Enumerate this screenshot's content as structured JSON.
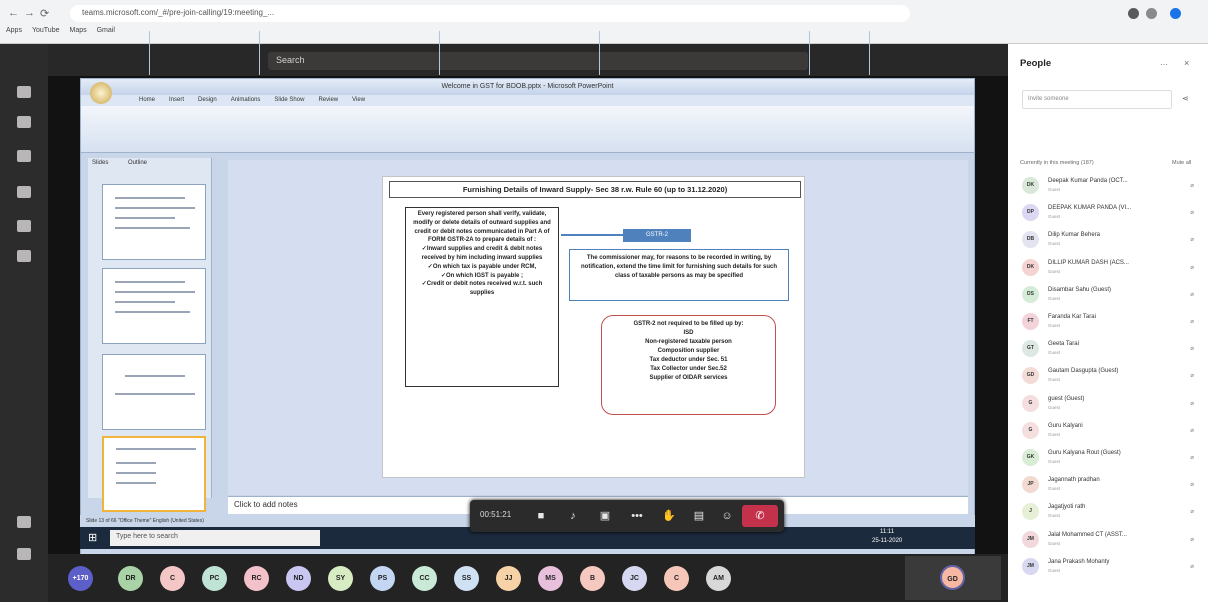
{
  "browser": {
    "url": "teams.microsoft.com/_#/pre-join-calling/19:meeting_...",
    "bookmarks": [
      "Apps",
      "YouTube",
      "Maps",
      "Gmail"
    ]
  },
  "teams": {
    "search_placeholder": "Search"
  },
  "ppt": {
    "title": "Welcome in GST for BDOB.pptx - Microsoft PowerPoint",
    "tabs": [
      "Home",
      "Insert",
      "Design",
      "Animations",
      "Slide Show",
      "Review",
      "View"
    ],
    "panel_tabs": [
      "Slides",
      "Outline"
    ],
    "notes": "Click to add notes",
    "status": "Slide 13 of 66   \"Office Theme\"   English (United States)"
  },
  "slide": {
    "title": "Furnishing Details of Inward Supply- Sec 38 r.w. Rule 60 (up to 31.12.2020)",
    "box_a": [
      "Every registered person shall verify, validate, modify or delete details of outward supplies and credit or debit notes communicated in Part A of FORM GSTR-2A to prepare details of :",
      "✓Inward supplies and credit & debit notes received by him including inward supplies",
      "✓On which tax is payable under RCM,",
      "✓On which IGST is payable ;",
      "✓Credit or debit notes received w.r.t. such supplies"
    ],
    "label": "GSTR-2",
    "box_b": "The commissioner may, for reasons to be recorded in writing, by notification, extend the time limit for furnishing such details for such class of taxable persons as may be specified",
    "box_c": [
      "GSTR-2 not required to be filled up by:",
      "ISD",
      "Non-registered taxable person",
      "Composition supplier",
      "Tax deductor under Sec. 51",
      "Tax Collector under Sec.52",
      "Supplier of OIDAR services"
    ]
  },
  "taskbar": {
    "search": "Type here to search",
    "time": "11:11",
    "date": "25-11-2020"
  },
  "call": {
    "timer": "00:51:21"
  },
  "participants": [
    "+170",
    "DR",
    "C",
    "PC",
    "RC",
    "ND",
    "SY",
    "PS",
    "CC",
    "SS",
    "JJ",
    "MS",
    "B",
    "JC",
    "C",
    "AM",
    "GD"
  ],
  "people": {
    "title": "People",
    "invite_placeholder": "Invite someone",
    "in_meeting": "Currently in this meeting (187)",
    "mute_all": "Mute all",
    "list": [
      {
        "initials": "DK",
        "name": "Deepak Kumar Panda (OCT...",
        "role": "Guest"
      },
      {
        "initials": "DP",
        "name": "DEEPAK KUMAR PANDA (VI...",
        "role": "Guest"
      },
      {
        "initials": "DB",
        "name": "Dilip Kumar Behera",
        "role": "Guest"
      },
      {
        "initials": "DK",
        "name": "DILLIP KUMAR DASH (ACS...",
        "role": "Guest"
      },
      {
        "initials": "DS",
        "name": "Disambar Sahu (Guest)",
        "role": "Guest"
      },
      {
        "initials": "FT",
        "name": "Faranda Kar Tarai",
        "role": "Guest"
      },
      {
        "initials": "GT",
        "name": "Geeta Tarai",
        "role": "Guest"
      },
      {
        "initials": "GD",
        "name": "Gautam Dasgupta (Guest)",
        "role": "Guest"
      },
      {
        "initials": "G",
        "name": "guest (Guest)",
        "role": "Guest"
      },
      {
        "initials": "G",
        "name": "Guru Kalyani",
        "role": "Guest"
      },
      {
        "initials": "GK",
        "name": "Guru Kalyana Rout (Guest)",
        "role": "Guest"
      },
      {
        "initials": "JP",
        "name": "Jagannath pradhan",
        "role": "Guest"
      },
      {
        "initials": "J",
        "name": "Jagatjyoti rath",
        "role": "Guest"
      },
      {
        "initials": "JM",
        "name": "Jalal Mohammed CT (ASST...",
        "role": "Guest"
      },
      {
        "initials": "JM",
        "name": "Jana Prakash Mohanty",
        "role": "Guest"
      }
    ]
  },
  "colors": {
    "hangup": "#c4314b",
    "accent": "#4f81bd"
  }
}
